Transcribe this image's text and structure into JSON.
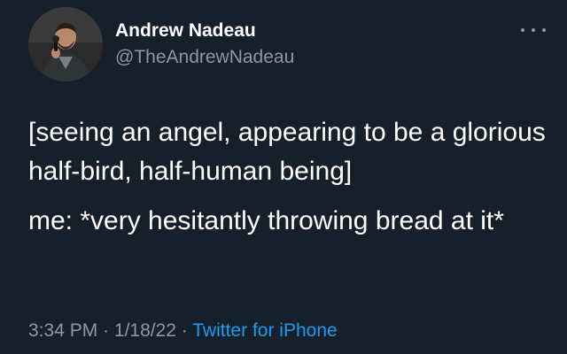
{
  "author": {
    "display_name": "Andrew Nadeau",
    "handle": "@TheAndrewNadeau"
  },
  "tweet": {
    "paragraphs": [
      "[seeing an angel, appearing to be a glorious half-bird, half-human being]",
      "me: *very hesitantly throwing bread at it*"
    ]
  },
  "meta": {
    "time": "3:34 PM",
    "separator1": " · ",
    "date": "1/18/22",
    "separator2": " · ",
    "source": "Twitter for iPhone"
  },
  "icons": {
    "more": "more-horizontal-icon"
  },
  "colors": {
    "background": "#15202b",
    "text": "#ffffff",
    "secondary": "#8b98a5",
    "accent": "#1d9bf0"
  }
}
